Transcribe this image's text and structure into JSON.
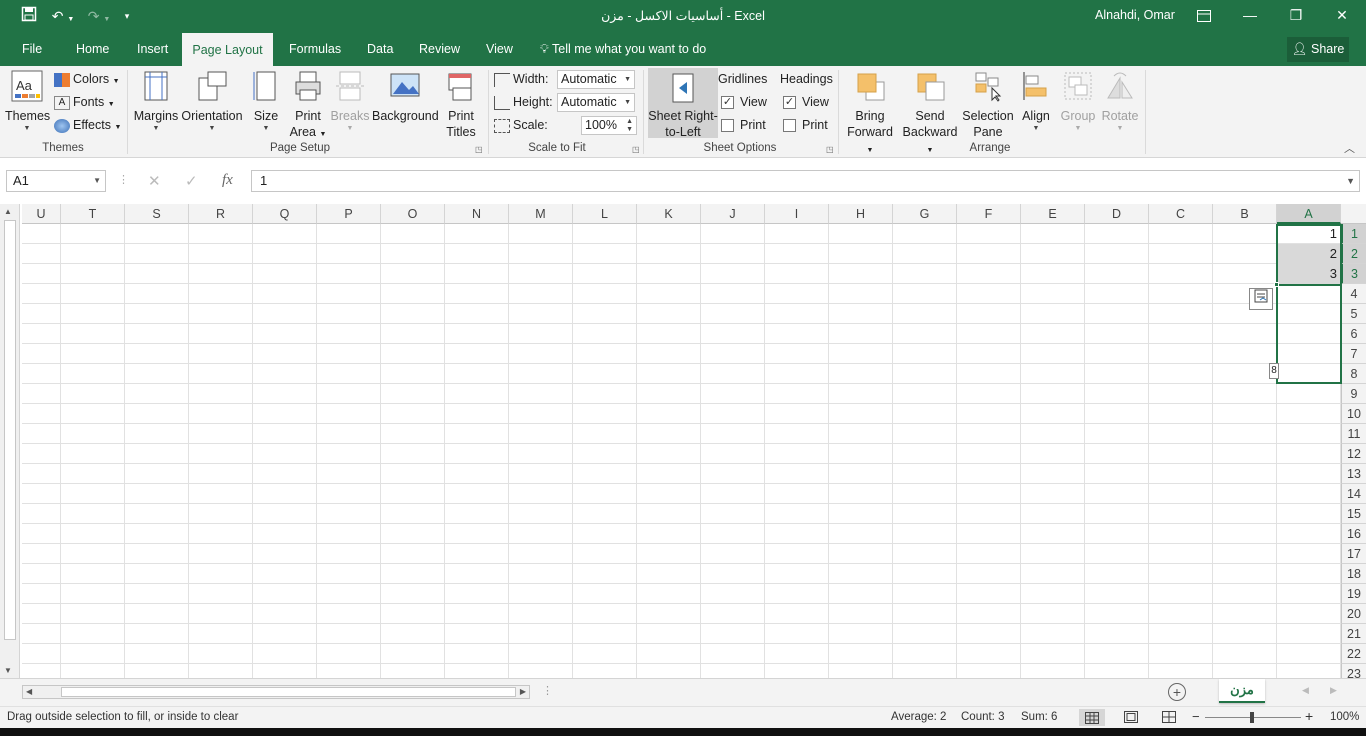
{
  "window": {
    "title": "أساسيات الاكسل - مزن - Excel",
    "user": "Alnahdi, Omar",
    "accent": "#217346"
  },
  "tabs": [
    {
      "label": "File"
    },
    {
      "label": "Home"
    },
    {
      "label": "Insert"
    },
    {
      "label": "Page Layout"
    },
    {
      "label": "Formulas"
    },
    {
      "label": "Data"
    },
    {
      "label": "Review"
    },
    {
      "label": "View"
    }
  ],
  "tell_me": "Tell me what you want to do",
  "share": "Share",
  "ribbon": {
    "themes": {
      "themes": "Themes",
      "colors": "Colors",
      "fonts": "Fonts",
      "effects": "Effects",
      "group": "Themes"
    },
    "page_setup": {
      "margins": "Margins",
      "orientation": "Orientation",
      "size": "Size",
      "print_area_1": "Print",
      "print_area_2": "Area",
      "breaks": "Breaks",
      "background": "Background",
      "print_titles_1": "Print",
      "print_titles_2": "Titles",
      "group": "Page Setup"
    },
    "scale": {
      "width_label": "Width:",
      "width_value": "Automatic",
      "height_label": "Height:",
      "height_value": "Automatic",
      "scale_label": "Scale:",
      "scale_value": "100%",
      "group": "Scale to Fit"
    },
    "sheet_options": {
      "rtl_1": "Sheet Right-",
      "rtl_2": "to-Left",
      "gridlines": "Gridlines",
      "headings": "Headings",
      "view": "View",
      "print": "Print",
      "group": "Sheet Options"
    },
    "arrange": {
      "bring_1": "Bring",
      "bring_2": "Forward",
      "send_1": "Send",
      "send_2": "Backward",
      "sel_1": "Selection",
      "sel_2": "Pane",
      "align": "Align",
      "group_btn": "Group",
      "rotate": "Rotate",
      "group": "Arrange"
    }
  },
  "formula_bar": {
    "name_box": "A1",
    "fx": "fx",
    "content": "1"
  },
  "columns": [
    "U",
    "T",
    "S",
    "R",
    "Q",
    "P",
    "O",
    "N",
    "M",
    "L",
    "K",
    "J",
    "I",
    "H",
    "G",
    "F",
    "E",
    "D",
    "C",
    "B",
    "A"
  ],
  "rows": [
    "1",
    "2",
    "3",
    "4",
    "5",
    "6",
    "7",
    "8",
    "9",
    "10",
    "11",
    "12",
    "13",
    "14",
    "15",
    "16",
    "17",
    "18",
    "19",
    "20",
    "21",
    "22",
    "23"
  ],
  "cells": {
    "A1": "1",
    "A2": "2",
    "A3": "3"
  },
  "fill_tooltip": "8",
  "sheet_tab": "مزن",
  "status": {
    "message": "Drag outside selection to fill, or inside to clear",
    "average": "Average: 2",
    "count": "Count: 3",
    "sum": "Sum: 6",
    "zoom": "100%"
  }
}
